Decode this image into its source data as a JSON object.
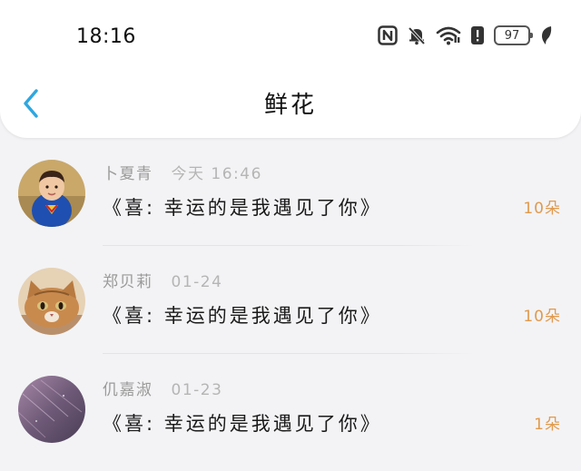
{
  "status_bar": {
    "time": "18:16",
    "battery": "97",
    "icons": [
      "nfc-icon",
      "bell-off-icon",
      "wifi-icon",
      "alert-icon",
      "battery-icon",
      "leaf-icon"
    ]
  },
  "nav": {
    "title": "鲜花",
    "back_icon": "chevron-left-icon",
    "accent_color": "#2ea7e0"
  },
  "colors": {
    "count": "#e09a4e",
    "meta": "#9a9a9a",
    "background": "#f3f3f5"
  },
  "items": [
    {
      "name": "卜夏青",
      "date": "今天 16:46",
      "message": "《喜:  幸运的是我遇见了你》",
      "count": "10朵",
      "avatar": "avatar-boy-superhero"
    },
    {
      "name": "郑贝莉",
      "date": "01-24",
      "message": "《喜:  幸运的是我遇见了你》",
      "count": "10朵",
      "avatar": "avatar-cat"
    },
    {
      "name": "仉嘉淑",
      "date": "01-23",
      "message": "《喜:  幸运的是我遇见了你》",
      "count": "1朵",
      "avatar": "avatar-purple-abstract"
    }
  ]
}
